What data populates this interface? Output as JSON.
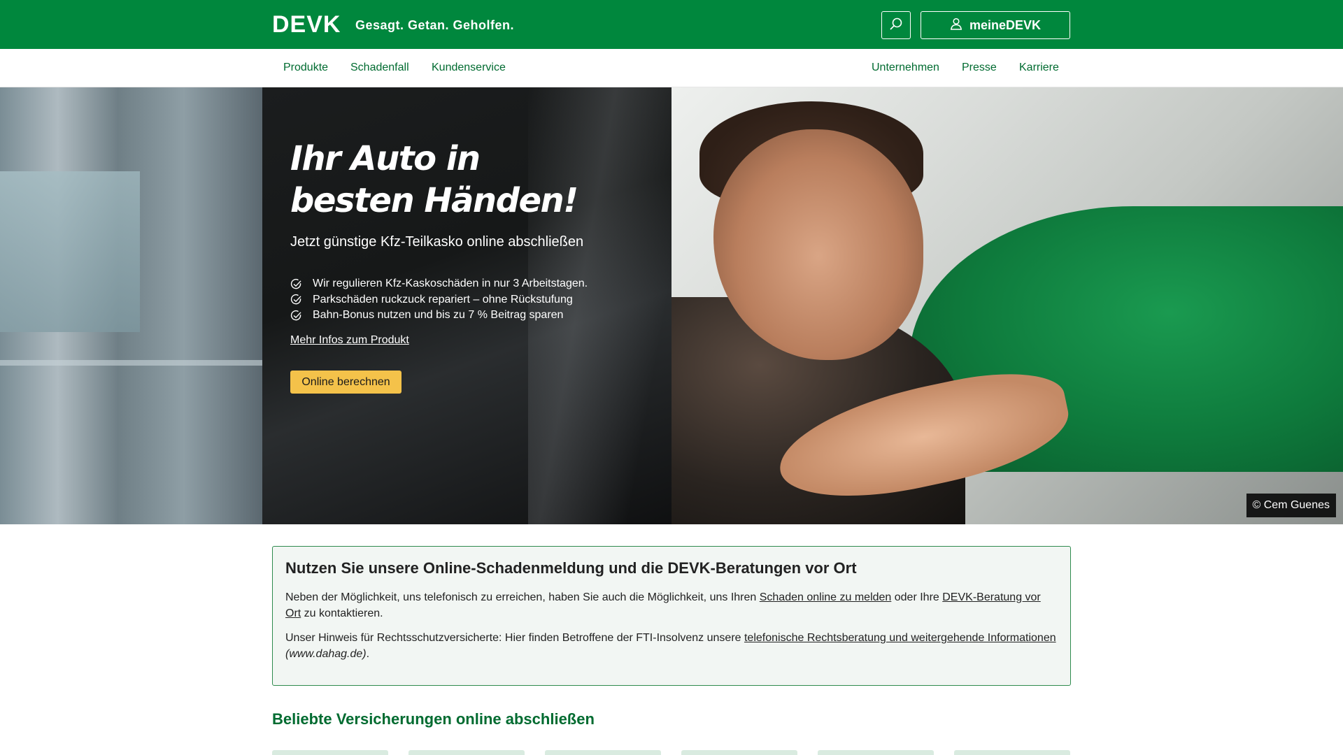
{
  "header": {
    "logo": "DEVK",
    "slogan": "Gesagt. Getan. Geholfen.",
    "search_icon": "search-icon",
    "login_icon": "user-icon",
    "login_label": "meineDEVK",
    "brand_color": "#00873d"
  },
  "nav": {
    "left": [
      {
        "label": "Produkte"
      },
      {
        "label": "Schadenfall"
      },
      {
        "label": "Kundenservice"
      }
    ],
    "right": [
      {
        "label": "Unternehmen"
      },
      {
        "label": "Presse"
      },
      {
        "label": "Karriere"
      }
    ]
  },
  "hero": {
    "title": "Ihr Auto in besten Händen!",
    "subtitle": "Jetzt günstige Kfz-Teilkasko online abschließen",
    "bullets": [
      "Wir regulieren Kfz-Kaskoschäden in nur 3 Arbeitstagen.",
      "Parkschäden ruckzuck repariert – ohne Rückstufung",
      "Bahn-Bonus nutzen und bis zu 7 % Beitrag sparen"
    ],
    "bullet_icon": "check-circle-icon",
    "more_link": "Mehr Infos zum Produkt",
    "cta_label": "Online berechnen",
    "cta_color": "#f4c24a",
    "photo_credit": "© Cem Guenes"
  },
  "info_box": {
    "title": "Nutzen Sie unsere Online-Schadenmeldung und die DEVK-Beratungen vor Ort",
    "p1_before": "Neben der Möglichkeit, uns telefonisch zu erreichen, haben Sie auch die Möglichkeit, uns Ihren ",
    "p1_link1": "Schaden online zu melden",
    "p1_middle": " oder Ihre ",
    "p1_link2": "DEVK-Beratung vor Ort",
    "p1_after": " zu kontaktieren.",
    "p2_before": "Unser Hinweis für Rechtsschutzversicherte: Hier finden Betroffene der FTI-Insolvenz unsere ",
    "p2_link": "telefonische Rechtsberatung und weitergehende Informationen",
    "p2_after_italic": "(www.dahag.de)",
    "p2_end": "."
  },
  "popular": {
    "title": "Beliebte Versicherungen online abschließen"
  }
}
